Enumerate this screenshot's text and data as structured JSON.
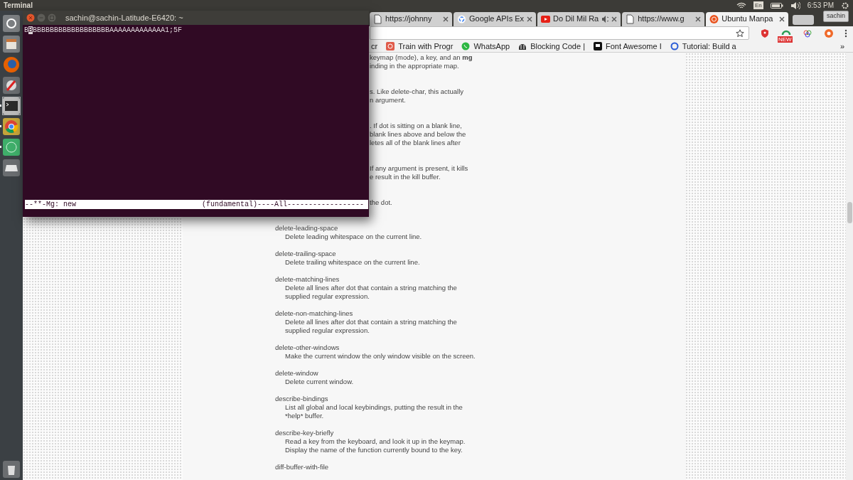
{
  "top_panel": {
    "title": "Terminal",
    "keyboard": "En",
    "time": "6:53 PM"
  },
  "launcher": [
    {
      "kind": "dash",
      "running": false,
      "selected": false
    },
    {
      "kind": "files",
      "running": false,
      "selected": false
    },
    {
      "kind": "firefox",
      "running": false,
      "selected": false
    },
    {
      "kind": "settings",
      "running": false,
      "selected": false
    },
    {
      "kind": "terminal",
      "running": true,
      "selected": true
    },
    {
      "kind": "chrome",
      "running": true,
      "selected": false
    },
    {
      "kind": "green",
      "running": true,
      "selected": false
    },
    {
      "kind": "drive",
      "running": false,
      "selected": false
    },
    {
      "kind": "trash",
      "running": false,
      "selected": false
    }
  ],
  "browser": {
    "tabs": [
      {
        "title": "https://johnny",
        "kind": "page",
        "audio": false,
        "selected": false
      },
      {
        "title": "Google APIs Ex",
        "kind": "google",
        "audio": false,
        "selected": false
      },
      {
        "title": "Do Dil Mil Ra",
        "kind": "youtube",
        "audio": true,
        "selected": false
      },
      {
        "title": "https://www.g",
        "kind": "page",
        "audio": false,
        "selected": false
      },
      {
        "title": "Ubuntu Manpa",
        "kind": "ubuntu",
        "audio": false,
        "selected": true
      }
    ],
    "profile": "sachin",
    "extensions": [
      {
        "kind": "shield"
      },
      {
        "kind": "new",
        "badge": "NEW"
      },
      {
        "kind": "rings"
      },
      {
        "kind": "orange"
      }
    ],
    "bookmarks": [
      {
        "label": "cr",
        "kind": "plain"
      },
      {
        "label": "Train with Progr",
        "kind": "swirl"
      },
      {
        "label": "WhatsApp",
        "kind": "whatsapp"
      },
      {
        "label": "Blocking Code |",
        "kind": "helmet"
      },
      {
        "label": "Font Awesome I",
        "kind": "flag"
      },
      {
        "label": "Tutorial: Build a",
        "kind": "ring"
      }
    ],
    "bookmarks_more": "»",
    "covered_text": [
      {
        "lines": [
          "keymap (mode), a key, and an **mg**",
          "inding in the appropriate map."
        ]
      },
      {
        "lines": [
          "s.  Like delete-char, this actually",
          "n argument."
        ]
      },
      {
        "lines": [
          ".  If dot is sitting on a blank line,",
          "blank lines above and below the",
          "letes all of the blank lines after"
        ]
      },
      {
        "lines": [
          "If any argument is present, it kills",
          "e result in the kill buffer."
        ]
      },
      {
        "lines": [
          "the dot."
        ]
      }
    ],
    "entries": [
      {
        "name": "delete-leading-space",
        "description": [
          "Delete leading whitespace on the current line."
        ]
      },
      {
        "name": "delete-trailing-space",
        "description": [
          "Delete trailing whitespace on the current line."
        ]
      },
      {
        "name": "delete-matching-lines",
        "description": [
          "Delete all lines after dot that contain a string matching the",
          "supplied regular expression."
        ]
      },
      {
        "name": "delete-non-matching-lines",
        "description": [
          "Delete all lines after dot that contain a string matching the",
          "supplied regular expression."
        ]
      },
      {
        "name": "delete-other-windows",
        "description": [
          "Make the current window the only window visible on the screen."
        ]
      },
      {
        "name": "delete-window",
        "description": [
          "Delete current window."
        ]
      },
      {
        "name": "describe-bindings",
        "description": [
          "List all global and local keybindings, putting the result in the",
          "*help* buffer."
        ]
      },
      {
        "name": "describe-key-briefly",
        "description": [
          "Read a key from the keyboard, and look it up in the keymap.",
          "Display the name of the function currently bound to the key."
        ]
      },
      {
        "name": "diff-buffer-with-file"
      }
    ]
  },
  "terminal": {
    "title": "sachin@sachin-Latitude-E6420: ~",
    "before_cursor": "B",
    "cursor_char": "B",
    "after_cursor": "BBBBBBBBBBBBBBBBBBAAAAAAAAAAAAA1;5F",
    "mode_left": "--**-Mg: new",
    "mode_right": "(fundamental)----All------------------"
  }
}
